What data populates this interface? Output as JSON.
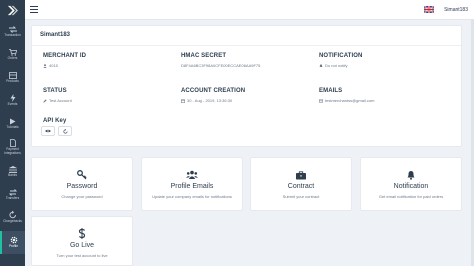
{
  "sidebar": {
    "items": [
      {
        "label": "Transaction",
        "icon": "arrows-icon"
      },
      {
        "label": "Orders",
        "icon": "cart-icon"
      },
      {
        "label": "Products",
        "icon": "products-icon"
      },
      {
        "label": "Events",
        "icon": "bolt-icon"
      },
      {
        "label": "Tutorials",
        "icon": "play-icon"
      },
      {
        "label": "Payment Integrations",
        "icon": "document-icon"
      },
      {
        "label": "Banks",
        "icon": "bank-icon"
      },
      {
        "label": "Transfers",
        "icon": "transfer-icon"
      },
      {
        "label": "Chargebacks",
        "icon": "chargeback-icon"
      },
      {
        "label": "Profile",
        "icon": "gear-icon"
      }
    ],
    "active_index": 9
  },
  "header": {
    "username": "Simant183",
    "flag": "uk-flag"
  },
  "profile": {
    "title": "Simant183",
    "merchant_id_label": "MERCHANT ID",
    "merchant_id_value": "4015",
    "hmac_label": "HMAC SECRET",
    "hmac_value": "D8F4A6BC3F98A0CFE00ECCAE06AA9F75",
    "notification_label": "NOTIFICATION",
    "notification_value": "Do not notify",
    "status_label": "STATUS",
    "status_value": "Test Account",
    "creation_label": "ACCOUNT CREATION",
    "creation_value": "30 - Aug - 2019, 13:36:30",
    "emails_label": "EMAILS",
    "emails_value": "testmerchantss@gmail.com",
    "apikey_label": "API Key"
  },
  "tiles": [
    {
      "title": "Password",
      "subtitle": "Change your password",
      "icon": "key-icon"
    },
    {
      "title": "Profile Emails",
      "subtitle": "Update your company emails for notifications",
      "icon": "users-icon"
    },
    {
      "title": "Contract",
      "subtitle": "Submit your contract",
      "icon": "briefcase-icon"
    },
    {
      "title": "Notification",
      "subtitle": "Get email notification for paid orders",
      "icon": "bell-icon"
    },
    {
      "title": "Go Live",
      "subtitle": "Turn your test account to live",
      "icon": "dollar-icon"
    }
  ],
  "colors": {
    "sidebar_bg": "#2f3e4e",
    "accent": "#1fc1a0",
    "text_dark": "#2c3e50",
    "text_muted": "#6c7a89"
  }
}
